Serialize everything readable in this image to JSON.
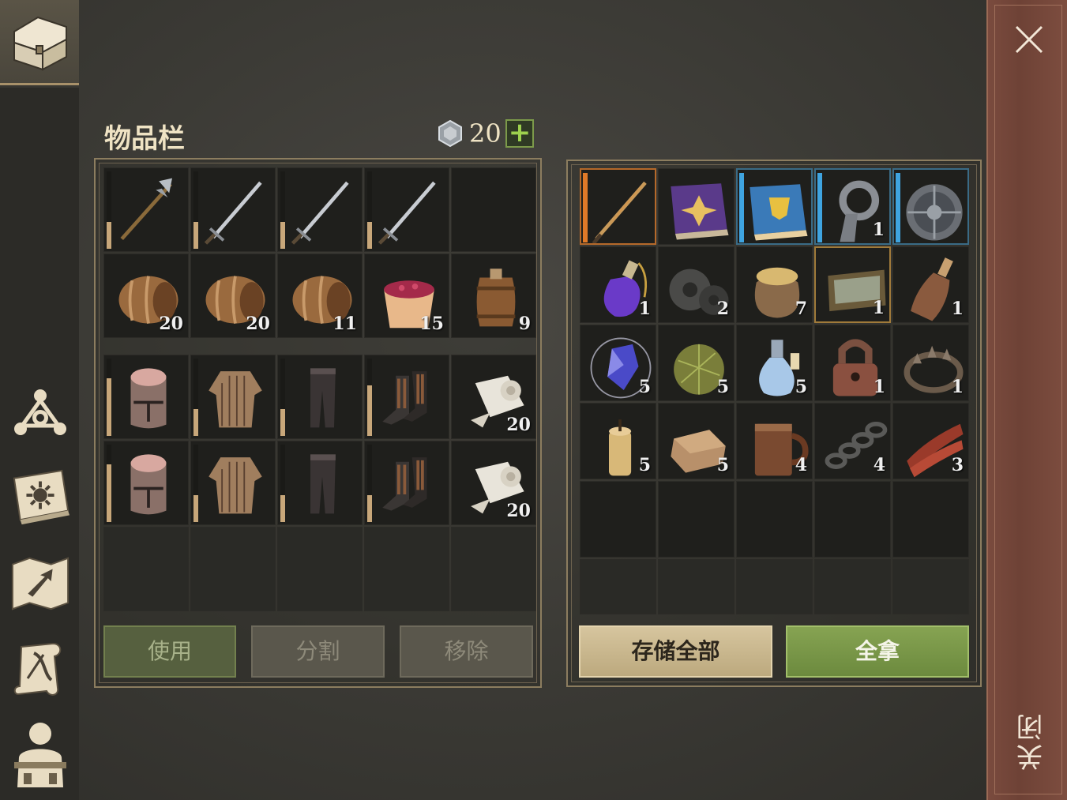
{
  "inventory": {
    "title": "物品栏",
    "gem_count": "20",
    "plus_label": "+"
  },
  "left_grid": [
    {
      "item": "halberd",
      "qty": "",
      "durability": 0.35
    },
    {
      "item": "sword",
      "qty": "",
      "durability": 0.35
    },
    {
      "item": "sword",
      "qty": "",
      "durability": 0.35
    },
    {
      "item": "sword",
      "qty": "",
      "durability": 0.35
    },
    {
      "item": "empty",
      "qty": "",
      "durability": null
    },
    {
      "item": "barrel-side",
      "qty": "20",
      "durability": null
    },
    {
      "item": "barrel-side",
      "qty": "20",
      "durability": null
    },
    {
      "item": "barrel-side",
      "qty": "11",
      "durability": null
    },
    {
      "item": "berry-bucket",
      "qty": "15",
      "durability": null
    },
    {
      "item": "barrel-upright",
      "qty": "9",
      "durability": null
    },
    {
      "item": "great-helm",
      "qty": "",
      "durability": 0.75
    },
    {
      "item": "chainmail",
      "qty": "",
      "durability": 0.35
    },
    {
      "item": "leggings",
      "qty": "",
      "durability": 0.35
    },
    {
      "item": "boots",
      "qty": "",
      "durability": 0.65
    },
    {
      "item": "cloth-roll",
      "qty": "20",
      "durability": null
    },
    {
      "item": "great-helm",
      "qty": "",
      "durability": 0.75
    },
    {
      "item": "chainmail",
      "qty": "",
      "durability": 0.35
    },
    {
      "item": "leggings",
      "qty": "",
      "durability": 0.35
    },
    {
      "item": "boots",
      "qty": "",
      "durability": 0.35
    },
    {
      "item": "cloth-roll",
      "qty": "20",
      "durability": null
    }
  ],
  "right_grid": [
    {
      "item": "flame-sword",
      "qty": "",
      "frame": "orange"
    },
    {
      "item": "purple-tome",
      "qty": "",
      "frame": "none"
    },
    {
      "item": "blue-tome",
      "qty": "",
      "frame": "blue"
    },
    {
      "item": "iron-ring",
      "qty": "1",
      "frame": "blue"
    },
    {
      "item": "round-shield",
      "qty": "",
      "frame": "blue"
    },
    {
      "item": "purple-potion",
      "qty": "1",
      "frame": "none"
    },
    {
      "item": "gears",
      "qty": "2",
      "frame": "none"
    },
    {
      "item": "grain-sack",
      "qty": "7",
      "frame": "none"
    },
    {
      "item": "tray",
      "qty": "1",
      "frame": "gold"
    },
    {
      "item": "bottle",
      "qty": "1",
      "frame": "none"
    },
    {
      "item": "crystal",
      "qty": "5",
      "frame": "none"
    },
    {
      "item": "fiber-ball",
      "qty": "5",
      "frame": "none"
    },
    {
      "item": "water-flask",
      "qty": "5",
      "frame": "none"
    },
    {
      "item": "padlock",
      "qty": "1",
      "frame": "none"
    },
    {
      "item": "bear-trap",
      "qty": "1",
      "frame": "none"
    },
    {
      "item": "candle",
      "qty": "5",
      "frame": "none"
    },
    {
      "item": "leather",
      "qty": "5",
      "frame": "none"
    },
    {
      "item": "tankard",
      "qty": "4",
      "frame": "none"
    },
    {
      "item": "chain",
      "qty": "4",
      "frame": "none"
    },
    {
      "item": "meat-strips",
      "qty": "3",
      "frame": "none"
    }
  ],
  "buttons": {
    "use": "使用",
    "split": "分割",
    "remove": "移除",
    "store_all": "存储全部",
    "take_all": "全拿"
  },
  "close": {
    "label": "关闭"
  },
  "sidebar": {
    "icons": [
      "chest-icon",
      "skills-icon",
      "spellbook-icon",
      "map-icon",
      "scroll-icon",
      "character-icon"
    ]
  },
  "colors": {
    "accent_green": "#86a352",
    "accent_gold": "#c8a77a",
    "close_red": "#7a4b3e",
    "rarity_blue": "#3fa4e0",
    "rarity_orange": "#e07a28"
  }
}
